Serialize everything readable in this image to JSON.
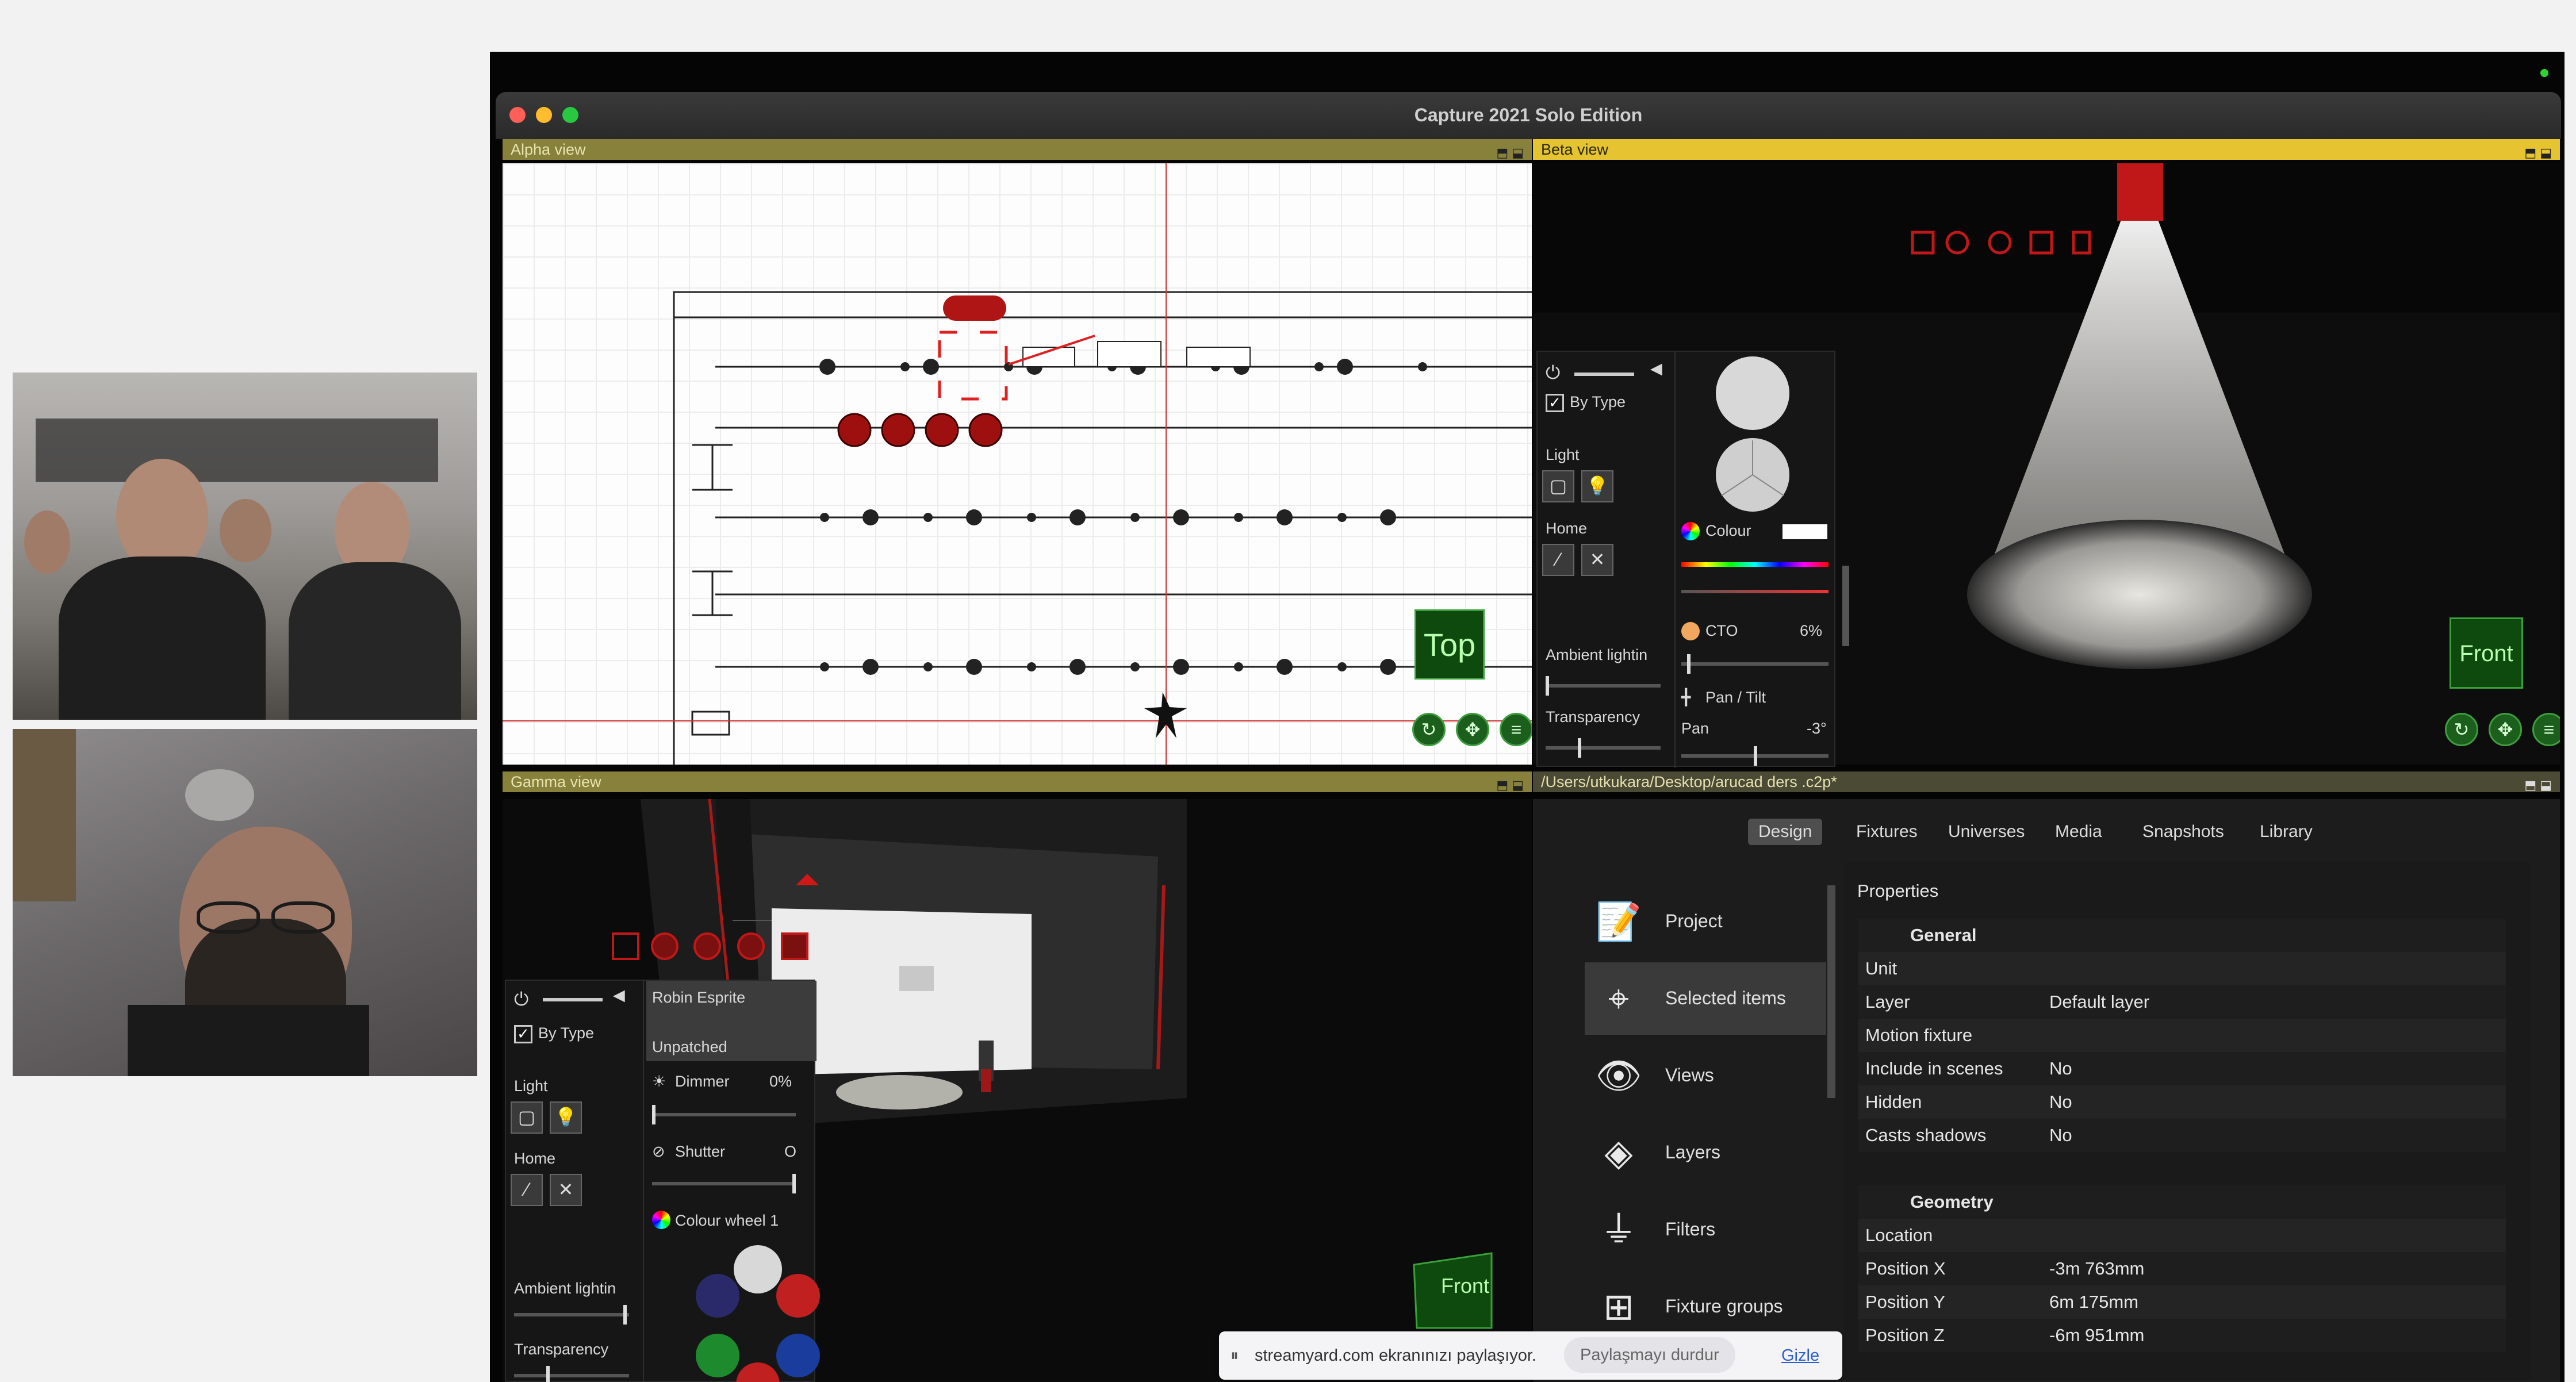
{
  "window": {
    "title": "Capture 2021 Solo Edition"
  },
  "views": {
    "alpha": {
      "title": "Alpha view",
      "label": "Top"
    },
    "beta": {
      "title": "Beta view",
      "label": "Front"
    },
    "gamma": {
      "title": "Gamma view",
      "label": "Front"
    },
    "file": {
      "title": "/Users/utkukara/Desktop/arucad ders .c2p*"
    }
  },
  "beta_panel": {
    "by_type": "By Type",
    "light": "Light",
    "home": "Home",
    "ambient": "Ambient lightin",
    "transparency": "Transparency",
    "colour": "Colour",
    "cto": "CTO",
    "cto_value": "6%",
    "pan_tilt": "Pan / Tilt",
    "pan": "Pan",
    "pan_value": "-3°"
  },
  "gamma_panel": {
    "by_type": "By Type",
    "light": "Light",
    "home": "Home",
    "ambient": "Ambient lightin",
    "transparency": "Transparency",
    "fixture_name": "Robin Esprite",
    "patch": "Unpatched",
    "dimmer": "Dimmer",
    "dimmer_value": "0%",
    "shutter": "Shutter",
    "shutter_value": "O",
    "colour_wheel": "Colour wheel 1"
  },
  "tabs": [
    "Design",
    "Fixtures",
    "Universes",
    "Media",
    "Snapshots",
    "Library"
  ],
  "menu": [
    "Project",
    "Selected items",
    "Views",
    "Layers",
    "Filters",
    "Fixture groups"
  ],
  "properties": {
    "title": "Properties",
    "general": "General",
    "rows1": [
      {
        "k": "Unit",
        "v": ""
      },
      {
        "k": "Layer",
        "v": "Default layer"
      },
      {
        "k": "Motion fixture",
        "v": ""
      },
      {
        "k": "Include in scenes",
        "v": "No"
      },
      {
        "k": "Hidden",
        "v": "No"
      },
      {
        "k": "Casts shadows",
        "v": "No"
      }
    ],
    "geometry": "Geometry",
    "rows2": [
      {
        "k": "Location",
        "v": ""
      },
      {
        "k": "Position X",
        "v": "-3m 763mm"
      },
      {
        "k": "Position Y",
        "v": "6m 175mm"
      },
      {
        "k": "Position Z",
        "v": "-6m 951mm"
      }
    ]
  },
  "share": {
    "text": "streamyard.com ekranınızı paylaşıyor.",
    "stop": "Paylaşmayı durdur",
    "hide": "Gizle"
  },
  "colors": {
    "accent_yellow": "#e6c331",
    "olive": "#87813b",
    "green": "#3aa03a",
    "red": "#c01818"
  }
}
